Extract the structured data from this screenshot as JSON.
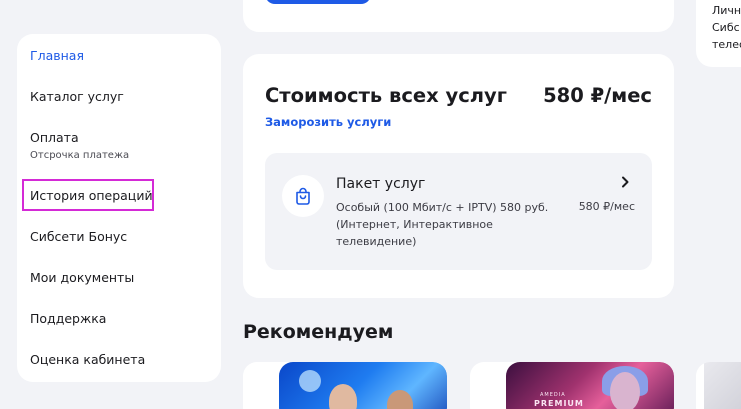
{
  "right_panel": {
    "lines": [
      "Личн",
      "Сибс",
      "телес"
    ]
  },
  "sidebar": {
    "items": [
      {
        "label": "Главная",
        "active": true
      },
      {
        "label": "Каталог услуг"
      },
      {
        "label": "Оплата",
        "sub": "Отсрочка платежа"
      },
      {
        "label": "История операций"
      },
      {
        "label": "Сибсети Бонус"
      },
      {
        "label": "Мои документы"
      },
      {
        "label": "Поддержка"
      },
      {
        "label": "Оценка кабинета"
      }
    ]
  },
  "cost": {
    "title": "Стоимость всех услуг",
    "total": "580 ₽/мес",
    "freeze_link": "Заморозить услуги",
    "package": {
      "icon": "shopping-bag-icon",
      "title": "Пакет услуг",
      "description": "Особый (100 Мбит/с + IPTV) 580 руб. (Интернет, Интерактивное телевидение)",
      "price": "580 ₽/мес"
    }
  },
  "recommend": {
    "title": "Рекомендуем",
    "card2_logo_small": "AMEDIA",
    "card2_logo": "PREMIUM"
  },
  "colors": {
    "accent": "#1e5ae6",
    "highlight": "#d42ad6",
    "background": "#f2f3f7"
  }
}
